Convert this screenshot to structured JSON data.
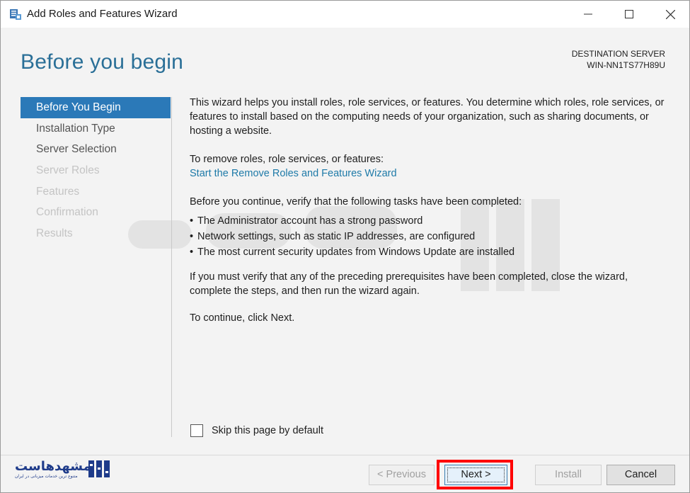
{
  "window": {
    "title": "Add Roles and Features Wizard"
  },
  "header": {
    "page_title": "Before you begin",
    "destination_label": "DESTINATION SERVER",
    "destination_server": "WIN-NN1TS77H89U"
  },
  "nav": {
    "items": [
      {
        "label": "Before You Begin",
        "state": "active"
      },
      {
        "label": "Installation Type",
        "state": "enabled"
      },
      {
        "label": "Server Selection",
        "state": "enabled"
      },
      {
        "label": "Server Roles",
        "state": "disabled"
      },
      {
        "label": "Features",
        "state": "disabled"
      },
      {
        "label": "Confirmation",
        "state": "disabled"
      },
      {
        "label": "Results",
        "state": "disabled"
      }
    ]
  },
  "content": {
    "intro": "This wizard helps you install roles, role services, or features. You determine which roles, role services, or features to install based on the computing needs of your organization, such as sharing documents, or hosting a website.",
    "remove_prompt": "To remove roles, role services, or features:",
    "remove_link": "Start the Remove Roles and Features Wizard",
    "verify_prompt": "Before you continue, verify that the following tasks have been completed:",
    "tasks": [
      "The Administrator account has a strong password",
      "Network settings, such as static IP addresses, are configured",
      "The most current security updates from Windows Update are installed"
    ],
    "verify_note": "If you must verify that any of the preceding prerequisites have been completed, close the wizard, complete the steps, and then run the wizard again.",
    "continue_note": "To continue, click Next."
  },
  "skip": {
    "label": "Skip this page by default",
    "checked": false
  },
  "buttons": {
    "previous": "< Previous",
    "next": "Next >",
    "install": "Install",
    "cancel": "Cancel"
  },
  "logo": {
    "name": "مشهدهاست",
    "tagline": "متنوع ترین خدمات میزبانی در ایران"
  },
  "colors": {
    "title_blue": "#2a6f97",
    "nav_active": "#2b79b8",
    "link": "#1e7aa8",
    "highlight": "#ff0000"
  }
}
